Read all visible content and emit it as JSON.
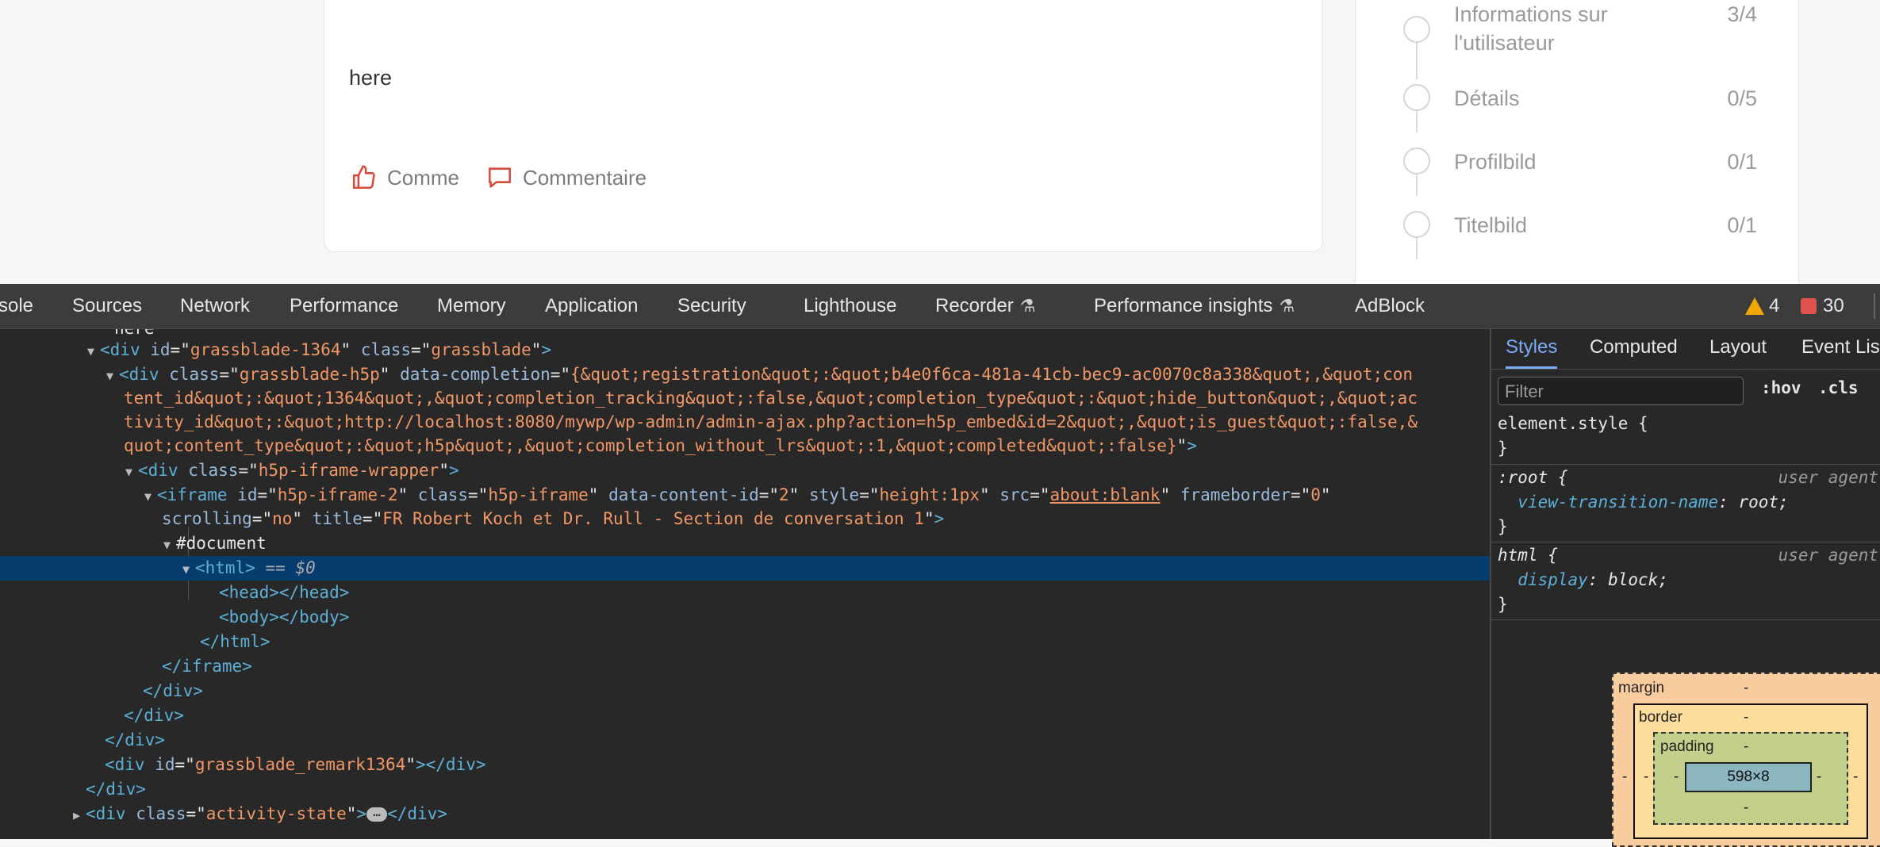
{
  "post": {
    "text": "here",
    "like_label": "Comme",
    "comment_label": "Commentaire"
  },
  "progress": {
    "steps": [
      {
        "label_line1": "Informations sur",
        "label_line2": "l'utilisateur",
        "count": "3/4"
      },
      {
        "label": "Détails",
        "count": "0/5"
      },
      {
        "label": "Profilbild",
        "count": "0/1"
      },
      {
        "label": "Titelbild",
        "count": "0/1"
      }
    ]
  },
  "devtools": {
    "tabs": [
      "sole",
      "Sources",
      "Network",
      "Performance",
      "Memory",
      "Application",
      "Security",
      "Lighthouse",
      "Recorder",
      "Performance insights",
      "AdBlock"
    ],
    "warnings": "4",
    "errors": "30",
    "tree": {
      "cut_text": "here",
      "div_grassblade": {
        "tag": "div",
        "id_attr": "id",
        "id_val": "grassblade-1364",
        "class_attr": "class",
        "class_val": "grassblade"
      },
      "div_h5p": {
        "tag": "div",
        "class_val": "grassblade-h5p",
        "attr": "data-completion",
        "line1": "{&quot;registration&quot;:&quot;b4e0f6ca-481a-41cb-bec9-ac0070c8a338&quot;,&quot;con",
        "line2": "tent_id&quot;:&quot;1364&quot;,&quot;completion_tracking&quot;:false,&quot;completion_type&quot;:&quot;hide_button&quot;,&quot;ac",
        "line3": "tivity_id&quot;:&quot;http://localhost:8080/mywp/wp-admin/admin-ajax.php?action=h5p_embed&id=2&quot;,&quot;is_guest&quot;:false,&",
        "line4": "quot;content_type&quot;:&quot;h5p&quot;,&quot;completion_without_lrs&quot;:1,&quot;completed&quot;:false}"
      },
      "div_wrapper_class": "h5p-iframe-wrapper",
      "iframe": {
        "id_val": "h5p-iframe-2",
        "class_val": "h5p-iframe",
        "content_id": "2",
        "style_val": "height:1px",
        "src_val": "about:blank",
        "frameborder_val": "0",
        "scrolling_val": "no",
        "title_val": "FR Robert Koch et Dr. Rull - Section de conversation 1"
      },
      "document": "#document",
      "html_sel": "== $0",
      "remark_id": "grassblade_remark1364",
      "activity_class": "activity-state"
    },
    "styles": {
      "tabs": [
        "Styles",
        "Computed",
        "Layout",
        "Event Listeners"
      ],
      "filter_placeholder": "Filter",
      "hov": ":hov",
      "cls": ".cls",
      "element_style": "element.style {",
      "close_brace": "}",
      "root_selector": ":root {",
      "root_prop": "view-transition-name",
      "root_val": "root;",
      "html_selector": "html {",
      "html_prop": "display",
      "html_val": "block;",
      "user_agent": "user agent"
    },
    "box_model": {
      "margin_label": "margin",
      "border_label": "border",
      "padding_label": "padding",
      "content": "598×8",
      "dash": "-"
    }
  }
}
